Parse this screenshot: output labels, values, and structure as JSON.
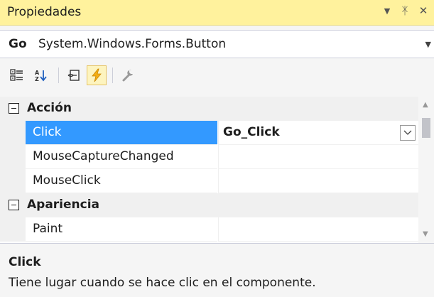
{
  "window": {
    "title": "Propiedades",
    "controls": [
      "▼",
      "ᛡ",
      "✕"
    ]
  },
  "object_selector": {
    "name": "Go",
    "type": "System.Windows.Forms.Button"
  },
  "toolbar": {
    "buttons": [
      {
        "icon": "categorized-icon",
        "checked": false
      },
      {
        "icon": "alphabetical-icon",
        "checked": false
      },
      {
        "icon": "properties-icon",
        "checked": false
      },
      {
        "icon": "events-icon",
        "checked": true
      },
      {
        "icon": "property-pages-icon",
        "checked": false
      }
    ]
  },
  "grid": {
    "categories": [
      {
        "label": "Acción",
        "rows": [
          {
            "name": "Click",
            "value": "Go_Click",
            "selected": true
          },
          {
            "name": "MouseCaptureChanged",
            "value": ""
          },
          {
            "name": "MouseClick",
            "value": ""
          }
        ]
      },
      {
        "label": "Apariencia",
        "rows": [
          {
            "name": "Paint",
            "value": ""
          }
        ]
      }
    ]
  },
  "description": {
    "title": "Click",
    "text": "Tiene lugar cuando se hace clic en el componente."
  },
  "colors": {
    "titlebar": "#fff29d",
    "selection": "#3399ff",
    "events_highlight": "#f5b016"
  }
}
